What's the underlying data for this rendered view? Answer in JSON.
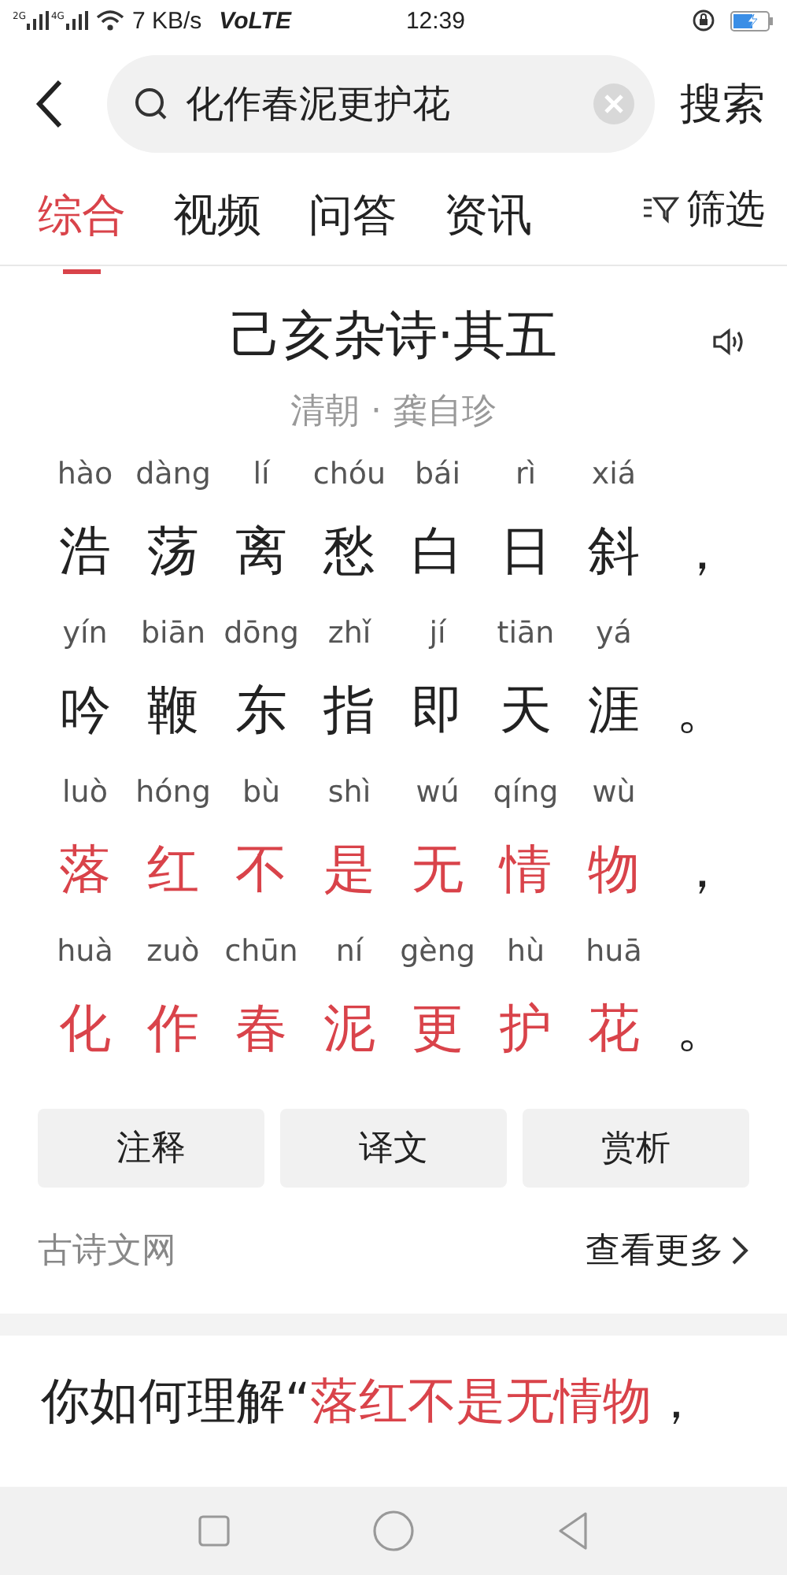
{
  "status_bar": {
    "network_left": "2G",
    "network_right": "4G",
    "speed": "7 KB/s",
    "volte": "VoLTE",
    "time": "12:39"
  },
  "search": {
    "value": "化作春泥更护花",
    "button": "搜索"
  },
  "tabs": [
    {
      "label": "综合",
      "selected": true
    },
    {
      "label": "视频",
      "selected": false
    },
    {
      "label": "问答",
      "selected": false
    },
    {
      "label": "资讯",
      "selected": false
    }
  ],
  "filter": "筛选",
  "poem": {
    "title": "己亥杂诗·其五",
    "author": "清朝 · 龚自珍",
    "lines": [
      {
        "highlight": false,
        "punct": "，",
        "chars": [
          {
            "py": "hào",
            "ch": "浩"
          },
          {
            "py": "dàng",
            "ch": "荡"
          },
          {
            "py": "lí",
            "ch": "离"
          },
          {
            "py": "chóu",
            "ch": "愁"
          },
          {
            "py": "bái",
            "ch": "白"
          },
          {
            "py": "rì",
            "ch": "日"
          },
          {
            "py": "xiá",
            "ch": "斜"
          }
        ]
      },
      {
        "highlight": false,
        "punct": "。",
        "chars": [
          {
            "py": "yín",
            "ch": "吟"
          },
          {
            "py": "biān",
            "ch": "鞭"
          },
          {
            "py": "dōng",
            "ch": "东"
          },
          {
            "py": "zhǐ",
            "ch": "指"
          },
          {
            "py": "jí",
            "ch": "即"
          },
          {
            "py": "tiān",
            "ch": "天"
          },
          {
            "py": "yá",
            "ch": "涯"
          }
        ]
      },
      {
        "highlight": true,
        "punct": "，",
        "chars": [
          {
            "py": "luò",
            "ch": "落"
          },
          {
            "py": "hóng",
            "ch": "红"
          },
          {
            "py": "bù",
            "ch": "不"
          },
          {
            "py": "shì",
            "ch": "是"
          },
          {
            "py": "wú",
            "ch": "无"
          },
          {
            "py": "qíng",
            "ch": "情"
          },
          {
            "py": "wù",
            "ch": "物"
          }
        ]
      },
      {
        "highlight": true,
        "punct": "。",
        "chars": [
          {
            "py": "huà",
            "ch": "化"
          },
          {
            "py": "zuò",
            "ch": "作"
          },
          {
            "py": "chūn",
            "ch": "春"
          },
          {
            "py": "ní",
            "ch": "泥"
          },
          {
            "py": "gèng",
            "ch": "更"
          },
          {
            "py": "hù",
            "ch": "护"
          },
          {
            "py": "huā",
            "ch": "花"
          }
        ]
      }
    ],
    "buttons": [
      "注释",
      "译文",
      "赏析"
    ],
    "source": "古诗文网",
    "more": "查看更多"
  },
  "question": [
    {
      "text": "你如何理解“",
      "highlight": false
    },
    {
      "text": "落红不是无情物",
      "highlight": true
    },
    {
      "text": "，",
      "highlight": false
    }
  ]
}
